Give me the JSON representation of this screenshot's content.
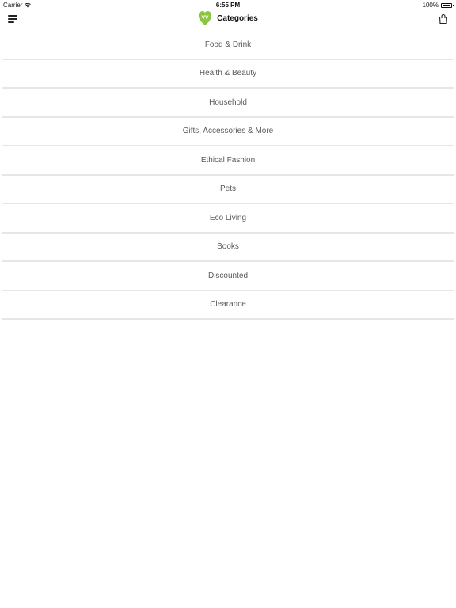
{
  "status_bar": {
    "carrier": "Carrier",
    "time": "6:55 PM",
    "battery": "100%"
  },
  "nav": {
    "title": "Categories",
    "menu_icon": "hamburger-menu-icon",
    "logo_icon": "leaf-logo-icon",
    "bag_icon": "shopping-bag-icon"
  },
  "colors": {
    "accent": "#8cc63f",
    "divider": "#e6e6e6",
    "row_text": "#5a5a5a"
  },
  "categories": [
    {
      "label": "Food & Drink"
    },
    {
      "label": "Health & Beauty"
    },
    {
      "label": "Household"
    },
    {
      "label": "Gifts, Accessories & More"
    },
    {
      "label": "Ethical Fashion"
    },
    {
      "label": "Pets"
    },
    {
      "label": "Eco Living"
    },
    {
      "label": "Books"
    },
    {
      "label": "Discounted"
    },
    {
      "label": "Clearance"
    }
  ]
}
